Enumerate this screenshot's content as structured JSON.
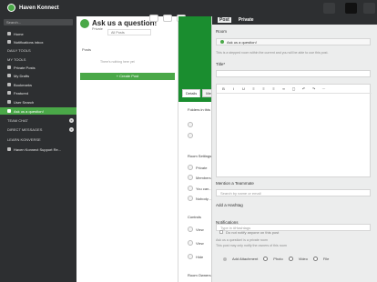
{
  "app": {
    "title": "Haven Konnect"
  },
  "sidebar": {
    "search_placeholder": "Search...",
    "items": [
      {
        "label": "Home"
      },
      {
        "label": "Notifications inbox"
      },
      {
        "label": "DAILY TOOLS"
      },
      {
        "label": "MY TOOLS"
      },
      {
        "label": "Private Posts"
      },
      {
        "label": "My Drafts"
      },
      {
        "label": "Bookmarks"
      },
      {
        "label": "Featured"
      },
      {
        "label": "User Search"
      },
      {
        "label": "Ask us a question!"
      }
    ],
    "sections": [
      {
        "label": "TEAM CHAT"
      },
      {
        "label": "DIRECT MESSAGES"
      },
      {
        "label": "LEARN KONVERSE"
      }
    ],
    "support_item": "Haven Konnect Support Re..."
  },
  "left_pane": {
    "title": "Ask us a question!",
    "subtitle": "Private",
    "posts_label": "Posts",
    "all_posts": "All Posts",
    "empty_note": "There's nothing here yet",
    "create_post": "+ Create Post"
  },
  "right_pane": {
    "tabs": [
      {
        "label": "Details"
      },
      {
        "label": "Members"
      }
    ],
    "folders_label": "Folders in this room",
    "room_settings_label": "Room Settings",
    "rows": [
      {
        "label": "Private"
      },
      {
        "label": "Members"
      },
      {
        "label": "You can..."
      },
      {
        "label": "Nobody..."
      }
    ],
    "controls_label": "Controls",
    "controls_rows": [
      {
        "label": "View"
      },
      {
        "label": "View"
      },
      {
        "label": "Hide"
      }
    ],
    "room_owners_label": "Room Owners"
  },
  "modal": {
    "tabs": [
      {
        "label": "Post"
      },
      {
        "label": "Private"
      }
    ],
    "room_label": "Room",
    "room_value": "Ask us a question!",
    "room_note": "This is a stepped room within the current and you will be able to use this post.",
    "title_label": "Title*",
    "mention_label": "Mention a Teammate",
    "mention_placeholder": "Search by name or email",
    "hashtag_label": "Add a Hashtag",
    "hashtag_placeholder": "Type in #Hashtags",
    "notifications_label": "Notifications",
    "notify_checkbox_label": "Do not notify anyone on this post",
    "notify_note1": "Ask us a question! is a private room",
    "notify_note2": "This post may only notify the owners of this room",
    "attachment_label": "Add Attachment",
    "attachment_types": [
      {
        "label": "Photo"
      },
      {
        "label": "Video"
      },
      {
        "label": "File"
      }
    ]
  }
}
